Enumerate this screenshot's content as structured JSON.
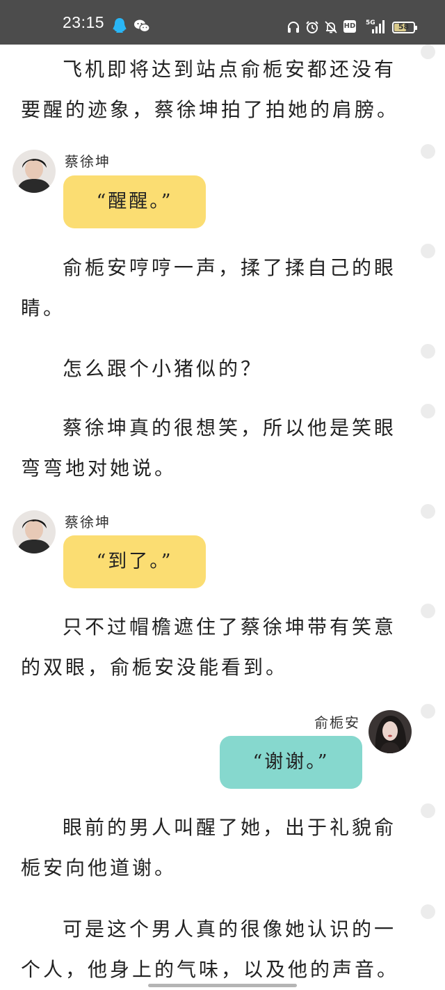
{
  "status_bar": {
    "time": "23:15",
    "icons": [
      "qq-icon",
      "wechat-icon",
      "headphones-icon",
      "alarm-icon",
      "mute-icon",
      "hd-icon",
      "5g-signal-icon",
      "battery-icon"
    ],
    "hd_label": "HD",
    "network": "5G",
    "battery_level": "58"
  },
  "story": {
    "paragraphs": [
      "飞机即将达到站点俞栀安都还没有要醒的迹象，蔡徐坤拍了拍她的肩膀。",
      "俞栀安哼哼一声，揉了揉自己的眼睛。",
      "怎么跟个小猪似的？",
      "蔡徐坤真的很想笑，所以他是笑眼弯弯地对她说。",
      "只不过帽檐遮住了蔡徐坤带有笑意的双眼，俞栀安没能看到。",
      "眼前的男人叫醒了她，出于礼貌俞栀安向他道谢。",
      "可是这个男人真的很像她认识的一个人，他身上的气味，以及他的声音。"
    ],
    "dialogues": [
      {
        "speaker": "蔡徐坤",
        "text": "“醒醒。”",
        "color": "#fbdd72"
      },
      {
        "speaker": "蔡徐坤",
        "text": "“到了。”",
        "color": "#fbdd72"
      },
      {
        "speaker": "俞栀安",
        "text": "“谢谢。”",
        "color": "#86d8ce"
      }
    ]
  }
}
